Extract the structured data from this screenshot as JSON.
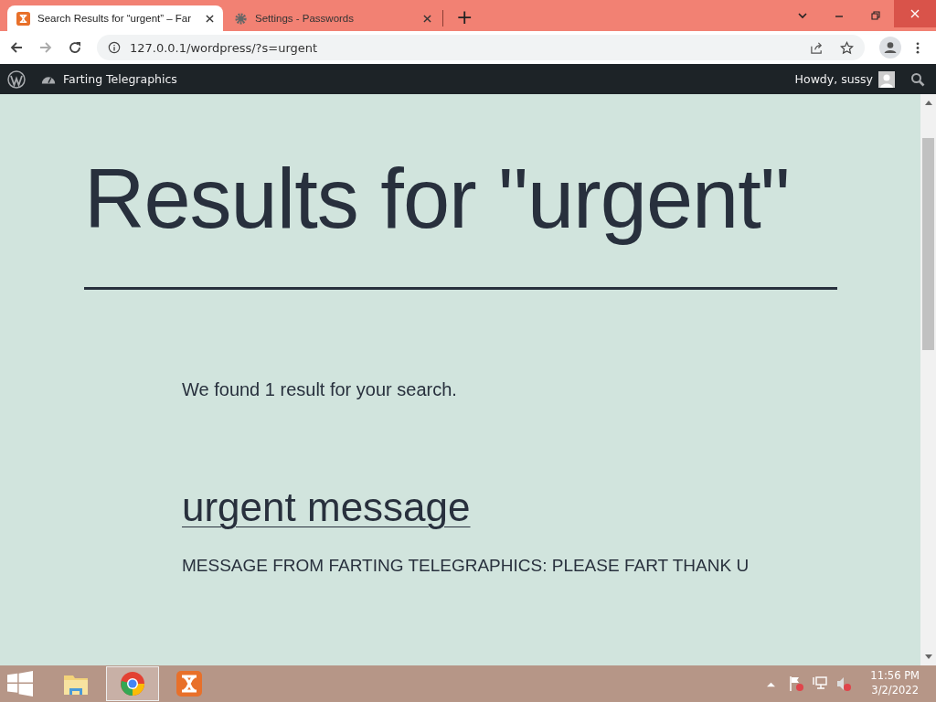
{
  "browser": {
    "tabs": [
      {
        "title": "Search Results for “urgent” – Far",
        "kind": "xampp",
        "selected": true
      },
      {
        "title": "Settings - Passwords",
        "kind": "gear",
        "selected": false
      }
    ],
    "new_tab": "+",
    "url": "127.0.0.1/wordpress/?s=urgent"
  },
  "admin_bar": {
    "site_name": "Farting Telegraphics",
    "greeting": "Howdy, sussy"
  },
  "page": {
    "title": "Results for \"urgent\"",
    "summary": "We found 1 result for your search.",
    "results": [
      {
        "title": "urgent message",
        "excerpt": "MESSAGE FROM FARTING TELEGRAPHICS: PLEASE FART THANK U"
      }
    ]
  },
  "taskbar": {
    "apps": [
      {
        "kind": "explorer",
        "selected": false
      },
      {
        "kind": "chrome",
        "selected": true
      },
      {
        "kind": "xampp",
        "selected": false
      }
    ],
    "time": "11:56 PM",
    "date": "3/2/2022"
  }
}
